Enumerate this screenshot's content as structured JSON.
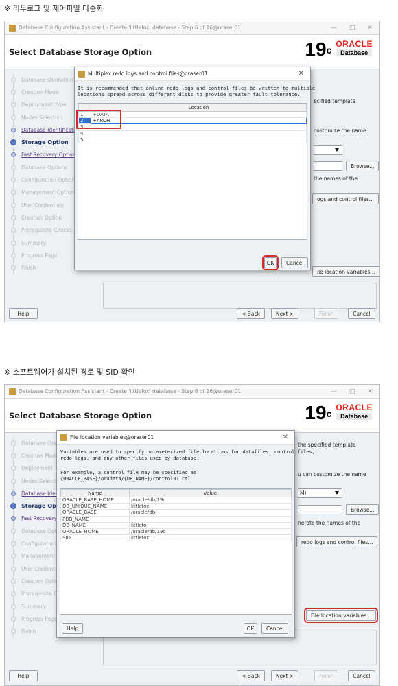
{
  "sections": [
    {
      "heading": "※ 리두로그 및 제어파일 다중화"
    },
    {
      "heading": "※ 소프트웨어가 설치된 경로 및 SID 확인"
    }
  ],
  "window": {
    "title": "Database Configuration Assistant - Create 'littlefox' database - Step 6 of 16@oraser01",
    "title_b": "Database Configuration Assistant - Create 'littlefox' database - Step 6 of 16@oraser01",
    "minimize": "—",
    "maximize": "□",
    "close": "✕",
    "page_title": "Select Database Storage Option",
    "logo_version": "19",
    "logo_version_sup": "c",
    "logo_brand": "ORACLE",
    "logo_product": "Database"
  },
  "steps": [
    {
      "label": "Database Operation",
      "state": "done"
    },
    {
      "label": "Creation Mode",
      "state": "done"
    },
    {
      "label": "Deployment Type",
      "state": "done"
    },
    {
      "label": "Nodes Selection",
      "state": "done"
    },
    {
      "label": "Database Identification",
      "state": "link"
    },
    {
      "label": "Storage Option",
      "state": "current"
    },
    {
      "label": "Fast Recovery Option",
      "state": "link"
    },
    {
      "label": "Database Options",
      "state": "todo"
    },
    {
      "label": "Configuration Options",
      "state": "todo"
    },
    {
      "label": "Management Options",
      "state": "todo"
    },
    {
      "label": "User Credentials",
      "state": "todo"
    },
    {
      "label": "Creation Option",
      "state": "todo"
    },
    {
      "label": "Prerequisite Checks",
      "state": "todo"
    },
    {
      "label": "Summary",
      "state": "todo"
    },
    {
      "label": "Progress Page",
      "state": "todo"
    },
    {
      "label": "Finish",
      "state": "todo"
    }
  ],
  "content_a": {
    "text_template": "ecified template",
    "text_customize": "customize the name",
    "browse": "Browse...",
    "text_names": "the names of the",
    "multiplex_btn": "ogs and control files...",
    "file_loc_btn": "ile location variables..."
  },
  "content_b": {
    "text_template": "the specified template",
    "text_customize": "u can customize the name",
    "combo_value": "M)",
    "browse": "Browse...",
    "text_names": "nerate the names of the",
    "multiplex_btn": "redo logs and control files...",
    "file_loc_btn": "File location variables..."
  },
  "footer": {
    "help": "Help",
    "back": "< Back",
    "next": "Next >",
    "finish": "Finish",
    "cancel": "Cancel"
  },
  "dialog_multiplex": {
    "title": "Multiplex redo logs and control files@oraser01",
    "close": "✕",
    "message": "It is recommended that online redo logs and control files be written to multiple\nlocations spread across different disks to provide greater fault tolerance.",
    "column": "Location",
    "rows": [
      {
        "num": "1",
        "location": "+DATA"
      },
      {
        "num": "2",
        "location": "+ARCH"
      },
      {
        "num": "3",
        "location": ""
      },
      {
        "num": "4",
        "location": ""
      },
      {
        "num": "5",
        "location": ""
      }
    ],
    "ok": "OK",
    "cancel": "Cancel"
  },
  "dialog_vars": {
    "title": "File location variables@oraser01",
    "close": "✕",
    "message": "Variables are used to specify parameterized file locations for datafiles, control files,\nredo logs, and any other files used by database.",
    "example": "For example, a control file may be specified as\n{ORACLE_BASE}/oradata/{DB_NAME}/control01.ctl",
    "col_name": "Name",
    "col_value": "Value",
    "rows": [
      {
        "name": "ORACLE_BASE_HOME",
        "value": "/oracle/db/19c"
      },
      {
        "name": "DB_UNIQUE_NAME",
        "value": "littlefox"
      },
      {
        "name": "ORACLE_BASE",
        "value": "/oracle/db"
      },
      {
        "name": "PDB_NAME",
        "value": ""
      },
      {
        "name": "DB_NAME",
        "value": "littlefo"
      },
      {
        "name": "ORACLE_HOME",
        "value": "/oracle/db/19c"
      },
      {
        "name": "SID",
        "value": "littlefox"
      }
    ],
    "help": "Help",
    "ok": "OK",
    "cancel": "Cancel"
  }
}
